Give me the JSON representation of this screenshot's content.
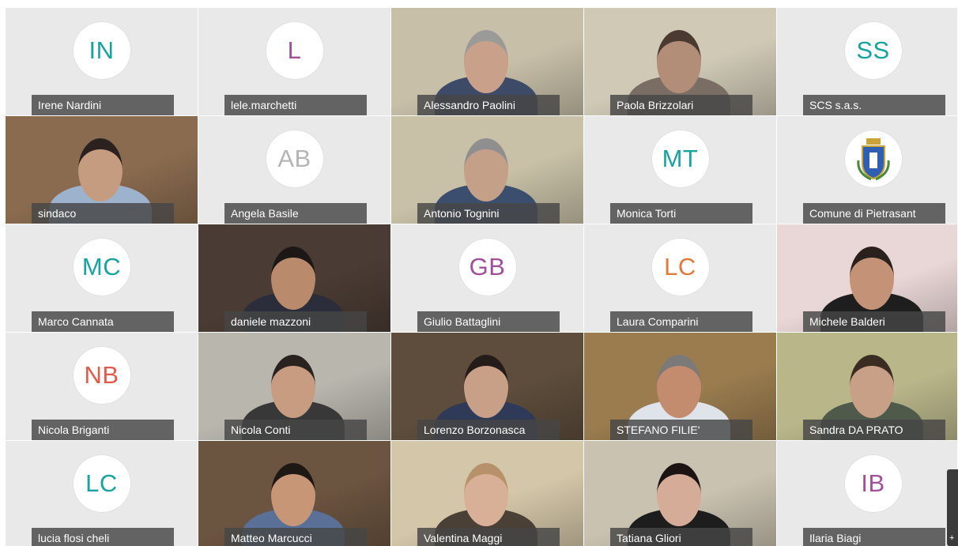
{
  "participants": [
    {
      "name": "Irene Nardini",
      "initials": "IN",
      "type": "avatar",
      "color": "#19a3a0"
    },
    {
      "name": "lele.marchetti",
      "initials": "L",
      "type": "avatar",
      "color": "#a0509b"
    },
    {
      "name": "Alessandro Paolini",
      "type": "video",
      "bg": "#c7bfa8",
      "skin": "#c9a18a",
      "hair": "#9a9a98",
      "shirt": "#3d4a68"
    },
    {
      "name": "Paola Brizzolari",
      "type": "video",
      "bg": "#cfc9b6",
      "skin": "#b28d77",
      "hair": "#4b3a30",
      "shirt": "#7a6e64"
    },
    {
      "name": "SCS s.a.s.",
      "initials": "SS",
      "type": "avatar",
      "color": "#19a3a0"
    },
    {
      "name": "sindaco",
      "type": "video",
      "bg": "#8a6b4f",
      "skin": "#c69c80",
      "hair": "#2b2220",
      "shirt": "#9db2cc"
    },
    {
      "name": "Angela Basile",
      "initials": "AB",
      "type": "avatar",
      "color": "#b5b5b5"
    },
    {
      "name": "Antonio Tognini",
      "type": "video",
      "bg": "#c8c1a7",
      "skin": "#c4a089",
      "hair": "#8f8f8f",
      "shirt": "#3c4e6e"
    },
    {
      "name": "Monica Torti",
      "initials": "MT",
      "type": "avatar",
      "color": "#19a3a0"
    },
    {
      "name": "Comune di Pietrasant",
      "type": "badge",
      "color": "#2f5fb0"
    },
    {
      "name": "Marco Cannata",
      "initials": "MC",
      "type": "avatar",
      "color": "#19a3a0"
    },
    {
      "name": "daniele mazzoni",
      "type": "video",
      "bg": "#4a3c34",
      "skin": "#b98a6c",
      "hair": "#1d1815",
      "shirt": "#2b2e3a"
    },
    {
      "name": "Giulio Battaglini",
      "initials": "GB",
      "type": "avatar",
      "color": "#a0509b"
    },
    {
      "name": "Laura Comparini",
      "initials": "LC",
      "type": "avatar",
      "color": "#e07a3a"
    },
    {
      "name": "Michele Balderi",
      "type": "video",
      "bg": "#e9d6d6",
      "skin": "#c49276",
      "hair": "#2a201c",
      "shirt": "#1e1e1e"
    },
    {
      "name": "Nicola Briganti",
      "initials": "NB",
      "type": "avatar",
      "color": "#e25a4a"
    },
    {
      "name": "Nicola Conti",
      "type": "video",
      "bg": "#b9b6ae",
      "skin": "#c89c80",
      "hair": "#2a221e",
      "shirt": "#383838"
    },
    {
      "name": "Lorenzo Borzonasca",
      "type": "video",
      "bg": "#5e4d3c",
      "skin": "#c8a088",
      "hair": "#241c18",
      "shirt": "#2f3a58"
    },
    {
      "name": "STEFANO FILIE'",
      "type": "video",
      "bg": "#9a7c4f",
      "skin": "#c48c6e",
      "hair": "#7c7a78",
      "shirt": "#dfe3ea"
    },
    {
      "name": "Sandra DA PRATO",
      "type": "video",
      "bg": "#b9b68a",
      "skin": "#c8a088",
      "hair": "#3b2c22",
      "shirt": "#4f5a4a"
    },
    {
      "name": "lucia flosi cheli",
      "initials": "LC",
      "type": "avatar",
      "color": "#19a3a0"
    },
    {
      "name": "Matteo Marcucci",
      "type": "video",
      "bg": "#6b5440",
      "skin": "#c69676",
      "hair": "#1e1814",
      "shirt": "#5a7096"
    },
    {
      "name": "Valentina Maggi",
      "type": "video",
      "bg": "#d4c6a8",
      "skin": "#d8b098",
      "hair": "#b7916a",
      "shirt": "#4a4036"
    },
    {
      "name": "Tatiana Gliori",
      "type": "video",
      "bg": "#c9c2b0",
      "skin": "#d4ac98",
      "hair": "#1b1413",
      "shirt": "#1d1d1d"
    },
    {
      "name": "Ilaria Biagi",
      "initials": "IB",
      "type": "avatar",
      "color": "#a0509b"
    }
  ],
  "scroll": {
    "glyph": "+"
  }
}
